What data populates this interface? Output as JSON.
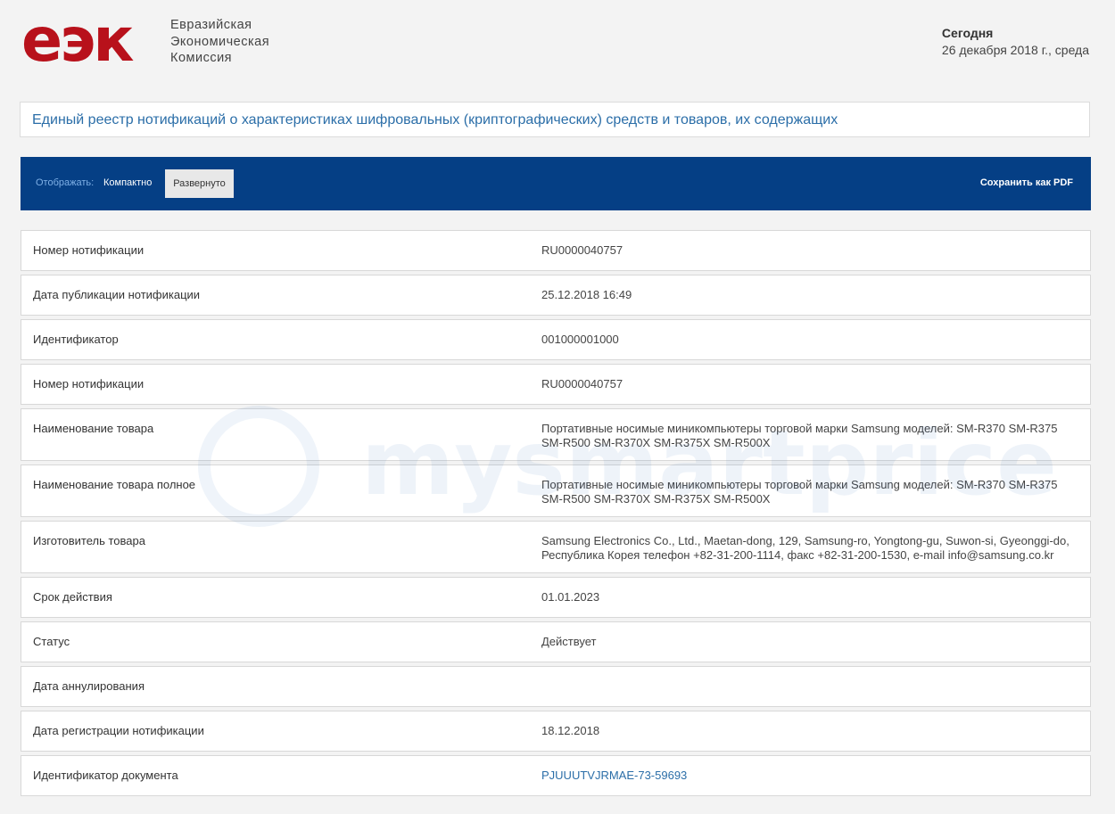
{
  "header": {
    "logo_mark": "еэк",
    "logo_text": [
      "Евразийская",
      "Экономическая",
      "Комиссия"
    ],
    "today_label": "Сегодня",
    "today_date": "26 декабря 2018 г., среда"
  },
  "registry_title": "Единый реестр нотификаций о характеристиках шифровальных (криптографических) средств и товаров, их содержащих",
  "toolbar": {
    "display_label": "Отображать:",
    "compact_label": "Компактно",
    "expanded_label": "Развернуто",
    "save_pdf_label": "Сохранить как PDF"
  },
  "rows": [
    {
      "label": "Номер нотификации",
      "value": "RU0000040757"
    },
    {
      "label": "Дата публикации нотификации",
      "value": "25.12.2018 16:49"
    },
    {
      "label": "Идентификатор",
      "value": "001000001000"
    },
    {
      "label": "Номер нотификации",
      "value": "RU0000040757"
    },
    {
      "label": "Наименование товара",
      "value": "Портативные носимые миникомпьютеры торговой марки Samsung моделей: SM-R370 SM-R375 SM-R500 SM-R370X SM-R375X SM-R500X"
    },
    {
      "label": "Наименование товара полное",
      "value": "Портативные носимые миникомпьютеры торговой марки Samsung моделей: SM-R370 SM-R375 SM-R500 SM-R370X SM-R375X SM-R500X"
    },
    {
      "label": "Изготовитель товара",
      "value": "Samsung Electronics Co., Ltd., Maetan-dong, 129, Samsung-ro, Yongtong-gu, Suwon-si, Gyeonggi-do, Республика Корея телефон +82-31-200-1114, факс +82-31-200-1530, e-mail info@samsung.co.kr"
    },
    {
      "label": "Срок действия",
      "value": "01.01.2023"
    },
    {
      "label": "Статус",
      "value": "Действует"
    },
    {
      "label": "Дата аннулирования",
      "value": ""
    },
    {
      "label": "Дата регистрации нотификации",
      "value": "18.12.2018"
    },
    {
      "label": "Идентификатор документа",
      "value": "PJUUUTVJRMAE-73-59693"
    }
  ],
  "watermark": {
    "text": "mysmartprice"
  },
  "colors": {
    "toolbar_bg": "#053f85",
    "logo": "#b8111b",
    "link": "#2b6ea8"
  }
}
